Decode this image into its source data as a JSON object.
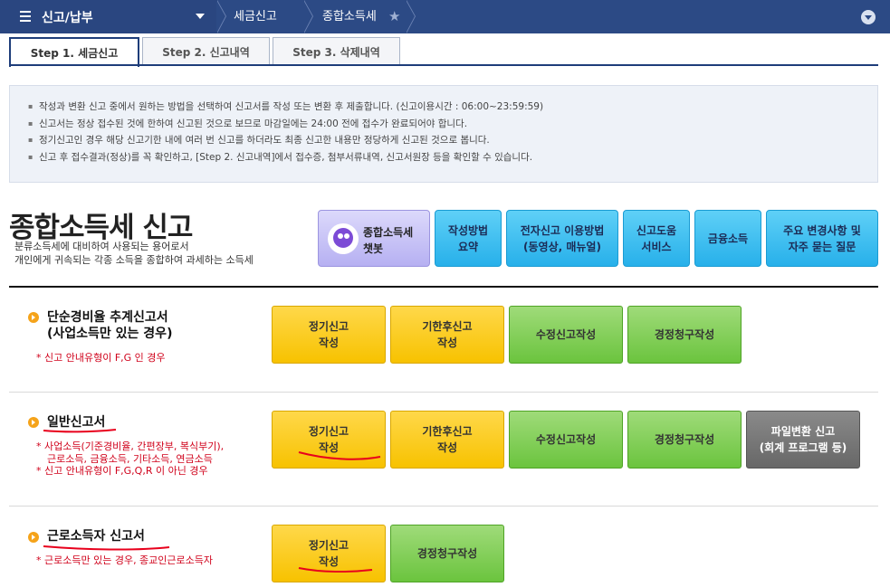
{
  "topbar": {
    "menu_title": "신고/납부",
    "crumbs": [
      "세금신고",
      "종합소득세"
    ]
  },
  "tabs": [
    {
      "label": "Step 1. 세금신고",
      "active": true
    },
    {
      "label": "Step 2. 신고내역",
      "active": false
    },
    {
      "label": "Step 3. 삭제내역",
      "active": false
    }
  ],
  "notice": [
    "작성과 변환 신고 중에서 원하는 방법을 선택하여 신고서를 작성 또는 변환 후 제출합니다. (신고이용시간 : 06:00~23:59:59)",
    "신고서는 정상 접수된 것에 한하여 신고된 것으로 보므로 마감일에는 24:00 전에 접수가 완료되어야 합니다.",
    "정기신고인 경우 해당 신고기한 내에 여러 번 신고를 하더라도 최종 신고한 내용만 정당하게 신고된 것으로 봅니다.",
    "신고 후 접수결과(정상)를 꼭 확인하고, [Step 2. 신고내역]에서 접수증, 첨부서류내역, 신고서원장 등을 확인할 수 있습니다."
  ],
  "section": {
    "title": "종합소득세 신고",
    "desc_line1": "분류소득세에 대비하여 사용되는 용어로서",
    "desc_line2": "개인에게 귀속되는 각종 소득을 종합하여 과세하는 소득세"
  },
  "quick_buttons": {
    "chatbot": {
      "line1": "종합소득세",
      "line2": "챗봇"
    },
    "guide": {
      "line1": "작성방법",
      "line2": "요약"
    },
    "how_to": {
      "line1": "전자신고 이용방법",
      "line2": "(동영상, 매뉴얼)"
    },
    "help": {
      "line1": "신고도움",
      "line2": "서비스"
    },
    "finance": {
      "line1": "금융소득"
    },
    "faq": {
      "line1": "주요 변경사항 및",
      "line2": "자주 묻는 질문"
    }
  },
  "rows": {
    "simple": {
      "title_line1": "단순경비율 추계신고서",
      "title_line2": "(사업소득만 있는 경우)",
      "note": "* 신고 안내유형이 F,G 인 경우",
      "btn_regular": {
        "line1": "정기신고",
        "line2": "작성"
      },
      "btn_late": {
        "line1": "기한후신고",
        "line2": "작성"
      },
      "btn_amend": "수정신고작성",
      "btn_claim": "경정청구작성"
    },
    "general": {
      "title": "일반신고서",
      "note1": "* 사업소득(기준경비율, 간편장부, 복식부기),",
      "note2": "근로소득, 금융소득, 기타소득, 연금소득",
      "note3": "* 신고 안내유형이 F,G,Q,R 이 아닌 경우",
      "btn_regular": {
        "line1": "정기신고",
        "line2": "작성"
      },
      "btn_late": {
        "line1": "기한후신고",
        "line2": "작성"
      },
      "btn_amend": "수정신고작성",
      "btn_claim": "경정청구작성",
      "btn_file": {
        "line1": "파일변환 신고",
        "line2": "(회계 프로그램 등)"
      }
    },
    "worker": {
      "title": "근로소득자 신고서",
      "note": "* 근로소득만 있는 경우, 종교인근로소득자",
      "btn_regular": {
        "line1": "정기신고",
        "line2": "작성"
      },
      "btn_claim": "경정청구작성"
    }
  },
  "colors": {
    "topbar": "#2c4a85",
    "yellow_btn": "#f7c200",
    "green_btn": "#6bc43e",
    "blue_btn": "#27b0ea",
    "red_note": "#d0021b"
  }
}
